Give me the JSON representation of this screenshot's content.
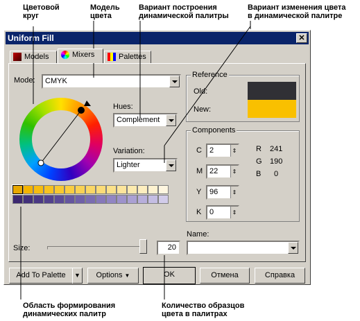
{
  "callouts": {
    "color_wheel": [
      "Цветовой",
      "круг"
    ],
    "color_model": [
      "Модель",
      "цвета"
    ],
    "palette_variant": [
      "Вариант построения",
      "динамической палитры"
    ],
    "color_change_variant": [
      "Вариант изменения цвета",
      "в динамической палитре"
    ],
    "palette_area": [
      "Область формирования",
      "динамических палитр"
    ],
    "sample_count": [
      "Количество образцов",
      "цвета в палитрах"
    ]
  },
  "window": {
    "title": "Uniform Fill",
    "close": "✕"
  },
  "tabs": [
    {
      "label": "Models",
      "icon": "models-icon",
      "active": false
    },
    {
      "label": "Mixers",
      "icon": "mixers-icon",
      "active": true
    },
    {
      "label": "Palettes",
      "icon": "palettes-icon",
      "active": false
    }
  ],
  "mode": {
    "label": "Mode:",
    "value": "CMYK"
  },
  "hues": {
    "label": "Hues:",
    "value": "Complement"
  },
  "variation": {
    "label": "Variation:",
    "value": "Lighter"
  },
  "reference": {
    "title": "Reference",
    "old_label": "Old:",
    "new_label": "New:",
    "old_color": "#303035",
    "new_color": "#f9c000"
  },
  "components": {
    "title": "Components",
    "cmyk": [
      {
        "label": "C",
        "value": "2"
      },
      {
        "label": "M",
        "value": "22"
      },
      {
        "label": "Y",
        "value": "96"
      },
      {
        "label": "K",
        "value": "0"
      }
    ],
    "rgb": [
      {
        "label": "R",
        "value": "241"
      },
      {
        "label": "G",
        "value": "190"
      },
      {
        "label": "B",
        "value": "0"
      }
    ]
  },
  "name": {
    "label": "Name:",
    "value": ""
  },
  "size": {
    "label": "Size:",
    "value": "20",
    "slider_fraction": 1.0
  },
  "palette": {
    "row1": [
      "#e8a800",
      "#f3b300",
      "#f6bc10",
      "#f7c220",
      "#f8c830",
      "#f9cd42",
      "#f9d254",
      "#fad766",
      "#fbdc78",
      "#fbe18a",
      "#fce59c",
      "#fceaae",
      "#fdeebf",
      "#fdf2d0",
      "#fef6e0"
    ],
    "row2": [
      "#3c2870",
      "#42307a",
      "#4a3884",
      "#52418d",
      "#5b4a96",
      "#65559f",
      "#6f60a8",
      "#7a6cb1",
      "#8678ba",
      "#9185c3",
      "#9d92cb",
      "#aaa0d3",
      "#b7aedb",
      "#c4bde3",
      "#d2ccea"
    ]
  },
  "buttons": {
    "add_to_palette": "Add To Palette",
    "options": "Options",
    "ok": "OK",
    "cancel": "Отмена",
    "help": "Справка"
  }
}
